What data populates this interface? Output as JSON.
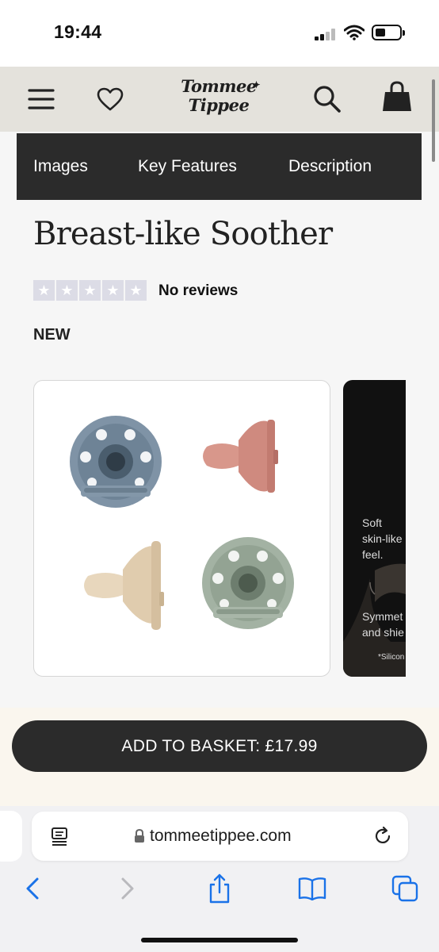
{
  "status_bar": {
    "time": "19:44",
    "icons": [
      "signal-icon",
      "wifi-icon",
      "battery-icon"
    ]
  },
  "header": {
    "logo_line1": "Tommee",
    "logo_line2": "Tippee",
    "icons": [
      "menu-icon",
      "heart-icon",
      "search-icon",
      "basket-icon"
    ]
  },
  "tabs": [
    {
      "label": "Images"
    },
    {
      "label": "Key Features"
    },
    {
      "label": "Description"
    }
  ],
  "product": {
    "title": "Breast-like Soother",
    "rating_stars": 0,
    "max_stars": 5,
    "reviews_label": "No reviews",
    "badge": "NEW"
  },
  "gallery": {
    "slide2_text": [
      "Soft",
      "skin-like",
      "feel.",
      "Symmet",
      "and shie",
      "*Silicon"
    ]
  },
  "basket": {
    "label": "ADD TO BASKET: ",
    "price": "£17.99"
  },
  "browser": {
    "url": "tommeetippee.com",
    "toolbar_icons": [
      "back-icon",
      "forward-icon",
      "share-icon",
      "bookmarks-icon",
      "tabs-icon"
    ]
  },
  "colors": {
    "header_bg": "#e4e2dc",
    "tab_bar_bg": "#2b2b2b",
    "basket_button": "#2b2b2b",
    "link_blue": "#1a72e8"
  }
}
